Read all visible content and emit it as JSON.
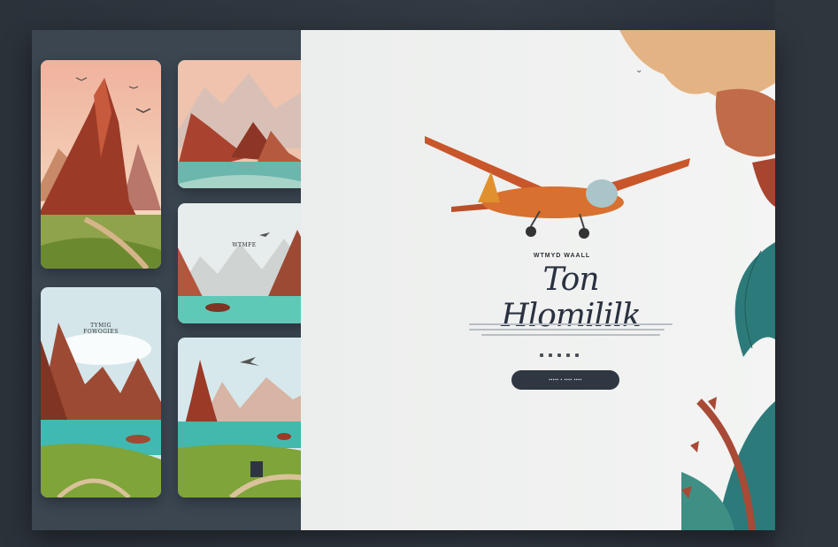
{
  "hero": {
    "subtitle": "WTMYD WAALL",
    "title": "Ton Hlomililk",
    "cta_label": "▪▪▪▪▪ ▪ ▪▪▪▪ ▪▪▪▪"
  },
  "cards": [
    {
      "caption": ""
    },
    {
      "caption": ""
    },
    {
      "caption": ""
    },
    {
      "caption_line1": "TYMIG",
      "caption_line2": "FOWOGIES"
    },
    {
      "caption": "WTMFE"
    },
    {
      "caption": ""
    },
    {
      "caption": ""
    },
    {
      "caption": ""
    }
  ],
  "colors": {
    "page_bg": "#2e353d",
    "left_panel": "#3b4651",
    "right_panel": "#eceeed",
    "plane": "#d86a2b",
    "accent_teal": "#2d7a7a",
    "rock": "#a84a36"
  },
  "icons": [
    "airplane-icon",
    "bird-icon",
    "leaf-icon"
  ]
}
